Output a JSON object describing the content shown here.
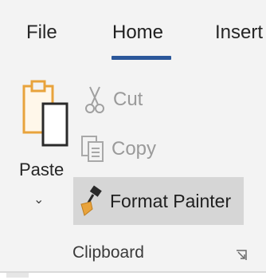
{
  "tabs": {
    "file": "File",
    "home": "Home",
    "insert": "Insert"
  },
  "clipboard": {
    "paste_label": "Paste",
    "paste_caret": "⌄",
    "cut_label": "Cut",
    "copy_label": "Copy",
    "format_painter_label": "Format Painter",
    "group_label": "Clipboard"
  },
  "colors": {
    "accent": "#2b579a",
    "paste_orange": "#e8a33c",
    "disabled_text": "#9a9a9a",
    "hover_bg": "#d6d6d6"
  },
  "icons": {
    "paste": "clipboard-paste-icon",
    "cut": "scissors-icon",
    "copy": "copy-icon",
    "format_painter": "paintbrush-icon",
    "launcher": "dialog-launcher-icon"
  }
}
